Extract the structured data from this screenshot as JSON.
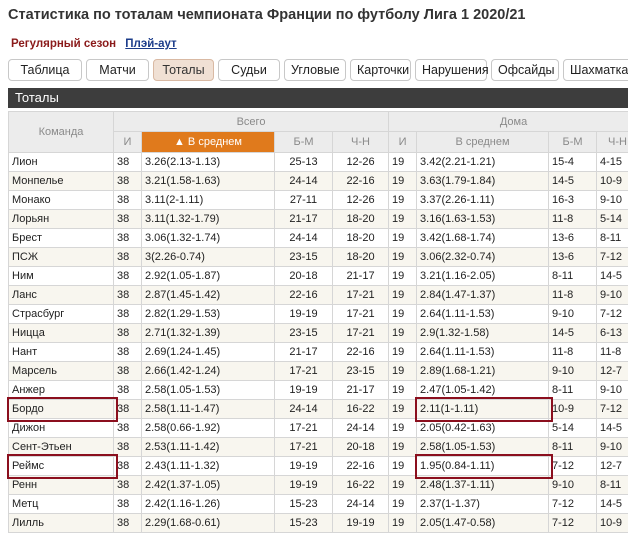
{
  "page": {
    "title": "Статистика по тоталам чемпионата Франции по футболу Лига 1 2020/21"
  },
  "subnav": {
    "active_label": "Регулярный сезон",
    "link_label": "Плэй-аут"
  },
  "tabs": [
    {
      "label": "Таблица",
      "selected": false
    },
    {
      "label": "Матчи",
      "selected": false
    },
    {
      "label": "Тоталы",
      "selected": true
    },
    {
      "label": "Судьи",
      "selected": false
    },
    {
      "label": "Угловые",
      "selected": false
    },
    {
      "label": "Карточки",
      "selected": false
    },
    {
      "label": "Нарушения",
      "selected": false
    },
    {
      "label": "Офсайды",
      "selected": false
    },
    {
      "label": "Шахматка",
      "selected": false
    },
    {
      "label": "Г",
      "selected": false
    }
  ],
  "section": {
    "title": "Тоталы"
  },
  "table": {
    "group_headers": {
      "team": "Команда",
      "total": "Всего",
      "home": "Дома"
    },
    "col_headers": {
      "games": "И",
      "avg_sorted": "▲ В среднем",
      "over_under": "Б-М",
      "odd_even": "Ч-Н",
      "home_games": "И",
      "home_avg": "В среднем",
      "home_over_under": "Б-М",
      "home_odd_even": "Ч-Н"
    },
    "rows": [
      {
        "team": "Лион",
        "g": "38",
        "avg": "3.26(2.13-1.13)",
        "bm": "25-13",
        "cn": "12-26",
        "hg": "19",
        "havg": "3.42(2.21-1.21)",
        "hbm": "15-4",
        "hcn": "4-15"
      },
      {
        "team": "Монпелье",
        "g": "38",
        "avg": "3.21(1.58-1.63)",
        "bm": "24-14",
        "cn": "22-16",
        "hg": "19",
        "havg": "3.63(1.79-1.84)",
        "hbm": "14-5",
        "hcn": "10-9"
      },
      {
        "team": "Монако",
        "g": "38",
        "avg": "3.11(2-1.11)",
        "bm": "27-11",
        "cn": "12-26",
        "hg": "19",
        "havg": "3.37(2.26-1.11)",
        "hbm": "16-3",
        "hcn": "9-10"
      },
      {
        "team": "Лорьян",
        "g": "38",
        "avg": "3.11(1.32-1.79)",
        "bm": "21-17",
        "cn": "18-20",
        "hg": "19",
        "havg": "3.16(1.63-1.53)",
        "hbm": "11-8",
        "hcn": "5-14"
      },
      {
        "team": "Брест",
        "g": "38",
        "avg": "3.06(1.32-1.74)",
        "bm": "24-14",
        "cn": "18-20",
        "hg": "19",
        "havg": "3.42(1.68-1.74)",
        "hbm": "13-6",
        "hcn": "8-11"
      },
      {
        "team": "ПСЖ",
        "g": "38",
        "avg": "3(2.26-0.74)",
        "bm": "23-15",
        "cn": "18-20",
        "hg": "19",
        "havg": "3.06(2.32-0.74)",
        "hbm": "13-6",
        "hcn": "7-12"
      },
      {
        "team": "Ним",
        "g": "38",
        "avg": "2.92(1.05-1.87)",
        "bm": "20-18",
        "cn": "21-17",
        "hg": "19",
        "havg": "3.21(1.16-2.05)",
        "hbm": "8-11",
        "hcn": "14-5"
      },
      {
        "team": "Ланс",
        "g": "38",
        "avg": "2.87(1.45-1.42)",
        "bm": "22-16",
        "cn": "17-21",
        "hg": "19",
        "havg": "2.84(1.47-1.37)",
        "hbm": "11-8",
        "hcn": "9-10"
      },
      {
        "team": "Страсбург",
        "g": "38",
        "avg": "2.82(1.29-1.53)",
        "bm": "19-19",
        "cn": "17-21",
        "hg": "19",
        "havg": "2.64(1.11-1.53)",
        "hbm": "9-10",
        "hcn": "7-12"
      },
      {
        "team": "Ницца",
        "g": "38",
        "avg": "2.71(1.32-1.39)",
        "bm": "23-15",
        "cn": "17-21",
        "hg": "19",
        "havg": "2.9(1.32-1.58)",
        "hbm": "14-5",
        "hcn": "6-13"
      },
      {
        "team": "Нант",
        "g": "38",
        "avg": "2.69(1.24-1.45)",
        "bm": "21-17",
        "cn": "22-16",
        "hg": "19",
        "havg": "2.64(1.11-1.53)",
        "hbm": "11-8",
        "hcn": "11-8"
      },
      {
        "team": "Марсель",
        "g": "38",
        "avg": "2.66(1.42-1.24)",
        "bm": "17-21",
        "cn": "23-15",
        "hg": "19",
        "havg": "2.89(1.68-1.21)",
        "hbm": "9-10",
        "hcn": "12-7"
      },
      {
        "team": "Анжер",
        "g": "38",
        "avg": "2.58(1.05-1.53)",
        "bm": "19-19",
        "cn": "21-17",
        "hg": "19",
        "havg": "2.47(1.05-1.42)",
        "hbm": "8-11",
        "hcn": "9-10"
      },
      {
        "team": "Бордо",
        "g": "38",
        "avg": "2.58(1.11-1.47)",
        "bm": "24-14",
        "cn": "16-22",
        "hg": "19",
        "havg": "2.11(1-1.11)",
        "hbm": "10-9",
        "hcn": "7-12"
      },
      {
        "team": "Дижон",
        "g": "38",
        "avg": "2.58(0.66-1.92)",
        "bm": "17-21",
        "cn": "24-14",
        "hg": "19",
        "havg": "2.05(0.42-1.63)",
        "hbm": "5-14",
        "hcn": "14-5"
      },
      {
        "team": "Сент-Этьен",
        "g": "38",
        "avg": "2.53(1.11-1.42)",
        "bm": "17-21",
        "cn": "20-18",
        "hg": "19",
        "havg": "2.58(1.05-1.53)",
        "hbm": "8-11",
        "hcn": "9-10"
      },
      {
        "team": "Реймс",
        "g": "38",
        "avg": "2.43(1.11-1.32)",
        "bm": "19-19",
        "cn": "22-16",
        "hg": "19",
        "havg": "1.95(0.84-1.11)",
        "hbm": "7-12",
        "hcn": "12-7"
      },
      {
        "team": "Ренн",
        "g": "38",
        "avg": "2.42(1.37-1.05)",
        "bm": "19-19",
        "cn": "16-22",
        "hg": "19",
        "havg": "2.48(1.37-1.11)",
        "hbm": "9-10",
        "hcn": "8-11"
      },
      {
        "team": "Метц",
        "g": "38",
        "avg": "2.42(1.16-1.26)",
        "bm": "15-23",
        "cn": "24-14",
        "hg": "19",
        "havg": "2.37(1-1.37)",
        "hbm": "7-12",
        "hcn": "14-5"
      },
      {
        "team": "Лилль",
        "g": "38",
        "avg": "2.29(1.68-0.61)",
        "bm": "15-23",
        "cn": "19-19",
        "hg": "19",
        "havg": "2.05(1.47-0.58)",
        "hbm": "7-12",
        "hcn": "10-9"
      }
    ]
  },
  "annotations": {
    "highlight_color": "#8b0f1e",
    "highlighted_teams": [
      "Бордо",
      "Реймс"
    ]
  }
}
